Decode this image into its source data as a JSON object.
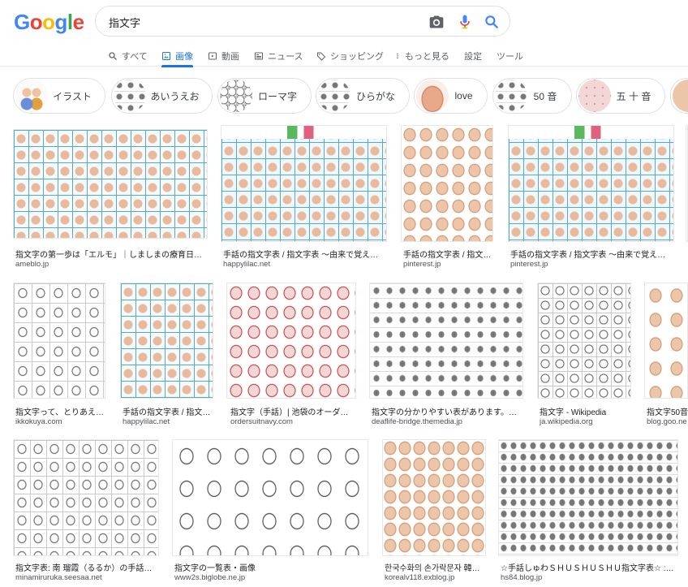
{
  "logo": {
    "letters": [
      "G",
      "o",
      "o",
      "g",
      "l",
      "e"
    ],
    "colors": [
      "#4285F4",
      "#EA4335",
      "#FBBC05",
      "#4285F4",
      "#34A853",
      "#EA4335"
    ]
  },
  "search": {
    "query": "指文字",
    "icons": [
      "camera-icon",
      "mic-icon",
      "search-icon"
    ]
  },
  "tabs": [
    {
      "label": "すべて",
      "icon": "search-icon",
      "active": false
    },
    {
      "label": "画像",
      "icon": "image-icon",
      "active": true
    },
    {
      "label": "動画",
      "icon": "video-icon",
      "active": false
    },
    {
      "label": "ニュース",
      "icon": "news-icon",
      "active": false
    },
    {
      "label": "ショッピング",
      "icon": "tag-icon",
      "active": false
    },
    {
      "label": "もっと見る",
      "icon": "more-vert-icon",
      "active": false
    },
    {
      "label": "設定",
      "active": false
    },
    {
      "label": "ツール",
      "active": false
    }
  ],
  "chips": [
    {
      "label": "イラスト"
    },
    {
      "label": "あいうえお"
    },
    {
      "label": "ローマ字"
    },
    {
      "label": "ひらがな"
    },
    {
      "label": "love"
    },
    {
      "label": "50 音"
    },
    {
      "label": "五 十 音"
    }
  ],
  "results": [
    {
      "title": "指文字の第一歩は「エルモ」｜しましまの療育日…",
      "site": "ameblo.jp"
    },
    {
      "title": "手話の指文字表 / 指文字表 〜由来で覚え…",
      "site": "happylilac.net"
    },
    {
      "title": "手話の指文字表 / 指文…",
      "site": "pinterest.jp"
    },
    {
      "title": "手話の指文字表 / 指文字表 〜由来で覚え…",
      "site": "pinterest.jp"
    },
    {
      "title": "指文字って、とりあえ…",
      "site": "ikkokuya.com"
    },
    {
      "title": "手話の指文字表 / 指文…",
      "site": "happylilac.net"
    },
    {
      "title": "指文字（手話）| 池袋のオーダ…",
      "site": "ordersuitnavy.com"
    },
    {
      "title": "指文字の分かりやすい表があります。…",
      "site": "deaflife-bridge.themedia.jp"
    },
    {
      "title": "指文字 - Wikipedia",
      "site": "ja.wikipedia.org"
    },
    {
      "title": "指文字50音",
      "site": "blog.goo.ne"
    },
    {
      "title": "指文字表: 南 瑠霞（るるか）の手話…",
      "site": "minamiruruka.seesaa.net"
    },
    {
      "title": "指文字の一覧表・画像",
      "site": "www2s.biglobe.ne.jp"
    },
    {
      "title": "한국수화의 손가락문자 韓国…",
      "site": "korealv118.exblog.jp"
    },
    {
      "title": "☆手話しゅわＳＨＵＳＨＵＳＨＵ指文字表☆ :…",
      "site": "hs84.blog.jp"
    }
  ]
}
